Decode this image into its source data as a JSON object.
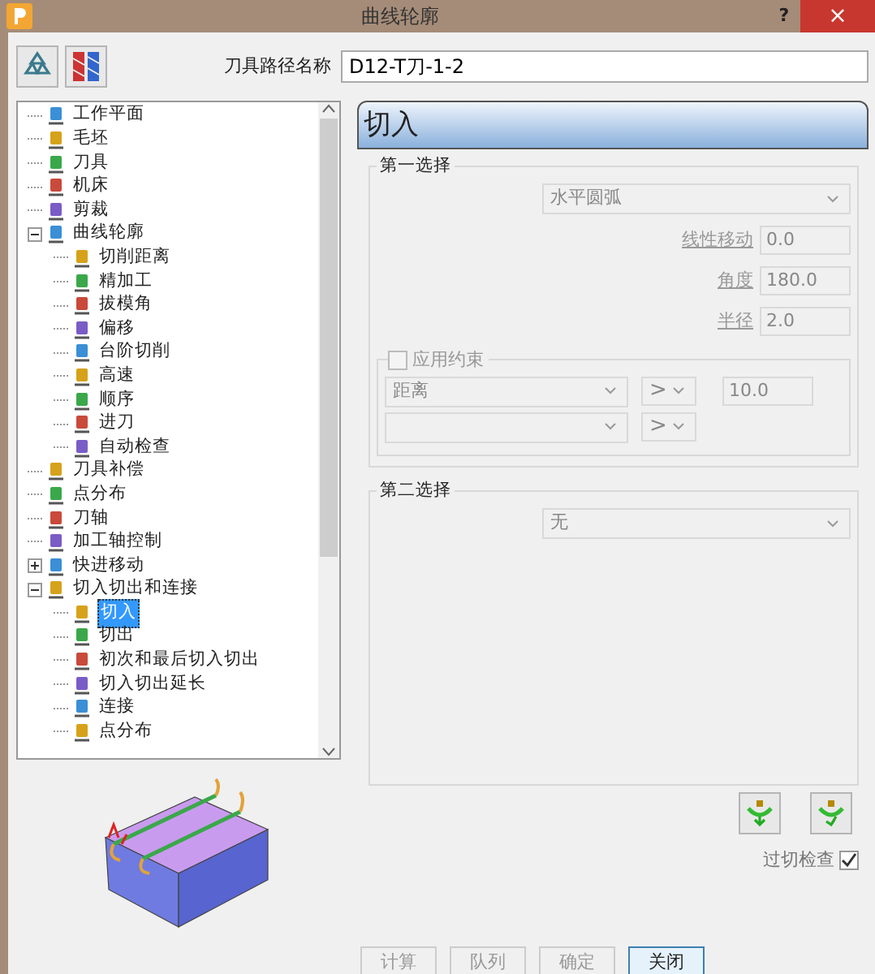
{
  "window": {
    "title": "曲线轮廓",
    "help": "?",
    "close": "×"
  },
  "toolpath_name": {
    "label": "刀具路径名称",
    "value": "D12-T刀-1-2"
  },
  "tree": [
    {
      "label": "工作平面",
      "selected": false
    },
    {
      "label": "毛坯",
      "selected": false
    },
    {
      "label": "刀具",
      "selected": false
    },
    {
      "label": "机床",
      "selected": false
    },
    {
      "label": "剪裁",
      "selected": false
    },
    {
      "label": "曲线轮廓",
      "selected": false,
      "expanded": true,
      "children": [
        {
          "label": "切削距离",
          "selected": false
        },
        {
          "label": "精加工",
          "selected": false
        },
        {
          "label": "拔模角",
          "selected": false
        },
        {
          "label": "偏移",
          "selected": false
        },
        {
          "label": "台阶切削",
          "selected": false
        },
        {
          "label": "高速",
          "selected": false
        },
        {
          "label": "顺序",
          "selected": false
        },
        {
          "label": "进刀",
          "selected": false
        },
        {
          "label": "自动检查",
          "selected": false
        }
      ]
    },
    {
      "label": "刀具补偿",
      "selected": false
    },
    {
      "label": "点分布",
      "selected": false
    },
    {
      "label": "刀轴",
      "selected": false
    },
    {
      "label": "加工轴控制",
      "selected": false
    },
    {
      "label": "快进移动",
      "selected": false,
      "expanded": false
    },
    {
      "label": "切入切出和连接",
      "selected": false,
      "expanded": true,
      "children": [
        {
          "label": "切入",
          "selected": true
        },
        {
          "label": "切出",
          "selected": false
        },
        {
          "label": "初次和最后切入切出",
          "selected": false
        },
        {
          "label": "切入切出延长",
          "selected": false
        },
        {
          "label": "连接",
          "selected": false
        },
        {
          "label": "点分布",
          "selected": false
        }
      ]
    }
  ],
  "page": {
    "title": "切入",
    "first_choice": {
      "title": "第一选择",
      "type": "水平圆弧",
      "disabled": true,
      "fields": [
        {
          "label": "线性移动",
          "value": "0.0"
        },
        {
          "label": "角度",
          "value": "180.0"
        },
        {
          "label": "半径",
          "value": "2.0"
        }
      ],
      "constraint": {
        "label": "应用约束",
        "checked": false,
        "rows": [
          {
            "measure": "距离",
            "operator": ">",
            "value": "10.0"
          },
          {
            "measure": "",
            "operator": ">"
          }
        ]
      }
    },
    "second_choice": {
      "title": "第二选择",
      "type": "无",
      "disabled": true
    },
    "overcut_check": {
      "label": "过切检查",
      "checked": true
    }
  },
  "buttons": [
    {
      "label": "计算",
      "disabled": true
    },
    {
      "label": "队列",
      "disabled": true
    },
    {
      "label": "确定",
      "disabled": true
    },
    {
      "label": "关闭",
      "disabled": false
    }
  ]
}
